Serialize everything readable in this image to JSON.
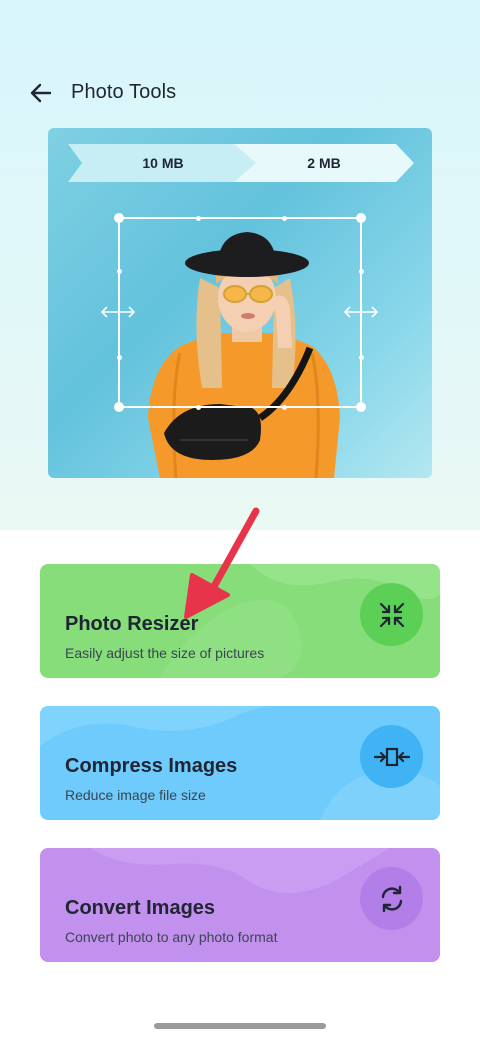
{
  "header": {
    "title": "Photo Tools"
  },
  "preview": {
    "original_size": "10 MB",
    "target_size": "2 MB"
  },
  "tools": [
    {
      "title": "Photo Resizer",
      "subtitle": "Easily adjust the size of  pictures",
      "icon": "resize-shrink-icon",
      "color": "#86dd79"
    },
    {
      "title": "Compress Images",
      "subtitle": "Reduce image file size",
      "icon": "compress-icon",
      "color": "#6fcbfb"
    },
    {
      "title": "Convert Images",
      "subtitle": "Convert photo to any photo format",
      "icon": "convert-refresh-icon",
      "color": "#c291ee"
    }
  ],
  "colors": {
    "annotation_arrow": "#e8344a",
    "text": "#1f2533"
  }
}
